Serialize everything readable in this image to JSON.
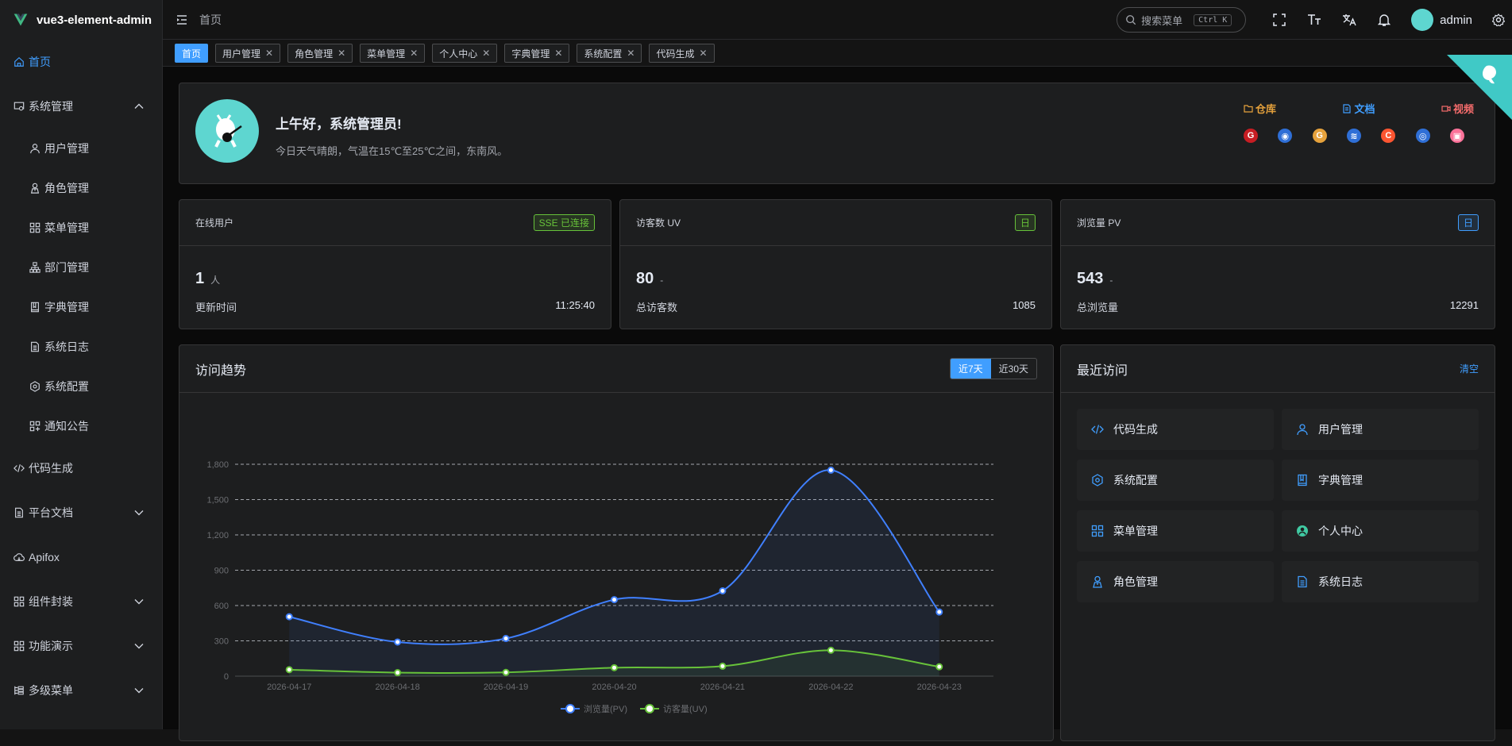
{
  "app": {
    "title": "vue3-element-admin"
  },
  "sidebar": {
    "items": [
      {
        "label": "首页",
        "icon": "home-icon",
        "active": true
      },
      {
        "label": "系统管理",
        "icon": "system-icon",
        "expanded": true
      },
      {
        "label": "用户管理",
        "icon": "user-icon",
        "sub": true
      },
      {
        "label": "角色管理",
        "icon": "role-icon",
        "sub": true
      },
      {
        "label": "菜单管理",
        "icon": "menu-icon",
        "sub": true
      },
      {
        "label": "部门管理",
        "icon": "tree-icon",
        "sub": true
      },
      {
        "label": "字典管理",
        "icon": "dict-icon",
        "sub": true
      },
      {
        "label": "系统日志",
        "icon": "document-icon",
        "sub": true
      },
      {
        "label": "系统配置",
        "icon": "setting-icon",
        "sub": true
      },
      {
        "label": "通知公告",
        "icon": "notice-icon",
        "sub": true
      },
      {
        "label": "代码生成",
        "icon": "code-icon"
      },
      {
        "label": "平台文档",
        "icon": "document-icon",
        "collapsed": true
      },
      {
        "label": "Apifox",
        "icon": "cloud-icon"
      },
      {
        "label": "组件封装",
        "icon": "menu-icon",
        "collapsed": true
      },
      {
        "label": "功能演示",
        "icon": "menu-icon",
        "collapsed": true
      },
      {
        "label": "多级菜单",
        "icon": "list-icon",
        "collapsed": true
      }
    ]
  },
  "topbar": {
    "breadcrumb": "首页",
    "search_placeholder": "搜索菜单",
    "search_shortcut": "Ctrl K",
    "user_name": "admin"
  },
  "tags": [
    {
      "label": "首页",
      "active": true
    },
    {
      "label": "用户管理"
    },
    {
      "label": "角色管理"
    },
    {
      "label": "菜单管理"
    },
    {
      "label": "个人中心"
    },
    {
      "label": "字典管理"
    },
    {
      "label": "系统配置"
    },
    {
      "label": "代码生成"
    }
  ],
  "welcome": {
    "greeting": "上午好，系统管理员!",
    "weather": "今日天气晴朗，气温在15℃至25℃之间，东南风。",
    "links": [
      {
        "label": "仓库",
        "color": "#e6a23c"
      },
      {
        "label": "文档",
        "color": "#409eff"
      },
      {
        "label": "视频",
        "color": "#f56c6c"
      }
    ],
    "icons": [
      {
        "glyph": "G",
        "color": "#c71d23"
      },
      {
        "glyph": "◉",
        "color": "#2f6fd6"
      },
      {
        "glyph": "G",
        "color": "#e6a23c"
      },
      {
        "glyph": "≋",
        "color": "#2f6fd6"
      },
      {
        "glyph": "C",
        "color": "#fc5531"
      },
      {
        "glyph": "◎",
        "color": "#2f6fd6"
      },
      {
        "glyph": "▣",
        "color": "#fb7299"
      }
    ]
  },
  "stats": [
    {
      "title": "在线用户",
      "badge": "SSE 已连接",
      "badge_color": "#67c23a",
      "value": "1",
      "unit": "人",
      "foot_label": "更新时间",
      "foot_value": "11:25:40"
    },
    {
      "title": "访客数 UV",
      "badge": "日",
      "badge_color": "#67c23a",
      "value": "80",
      "unit": "-",
      "foot_label": "总访客数",
      "foot_value": "1085"
    },
    {
      "title": "浏览量 PV",
      "badge": "日",
      "badge_color": "#409eff",
      "value": "543",
      "unit": "-",
      "foot_label": "总浏览量",
      "foot_value": "12291"
    }
  ],
  "trend": {
    "title": "访问趋势",
    "range_options": [
      "近7天",
      "近30天"
    ],
    "range_selected": "近7天"
  },
  "chart_data": {
    "type": "line",
    "x": [
      "2026-04-17",
      "2026-04-18",
      "2026-04-19",
      "2026-04-20",
      "2026-04-21",
      "2026-04-22",
      "2026-04-23"
    ],
    "series": [
      {
        "name": "浏览量(PV)",
        "color": "#4080ff",
        "values": [
          505,
          290,
          320,
          650,
          725,
          1750,
          545
        ]
      },
      {
        "name": "访客量(UV)",
        "color": "#67c23a",
        "values": [
          55,
          30,
          32,
          72,
          85,
          220,
          80
        ]
      }
    ],
    "yticks": [
      "0",
      "300",
      "600",
      "900",
      "1,200",
      "1,500",
      "1,800"
    ],
    "ylim": [
      0,
      1800
    ],
    "grid": true,
    "legend": "bottom-center"
  },
  "recent": {
    "title": "最近访问",
    "clear_label": "清空",
    "items": [
      {
        "label": "代码生成",
        "icon": "code-icon"
      },
      {
        "label": "用户管理",
        "icon": "user-icon"
      },
      {
        "label": "系统配置",
        "icon": "setting-icon"
      },
      {
        "label": "字典管理",
        "icon": "dict-icon"
      },
      {
        "label": "菜单管理",
        "icon": "menu-icon"
      },
      {
        "label": "个人中心",
        "icon": "profile-icon"
      },
      {
        "label": "角色管理",
        "icon": "role-icon"
      },
      {
        "label": "系统日志",
        "icon": "document-icon"
      }
    ]
  }
}
